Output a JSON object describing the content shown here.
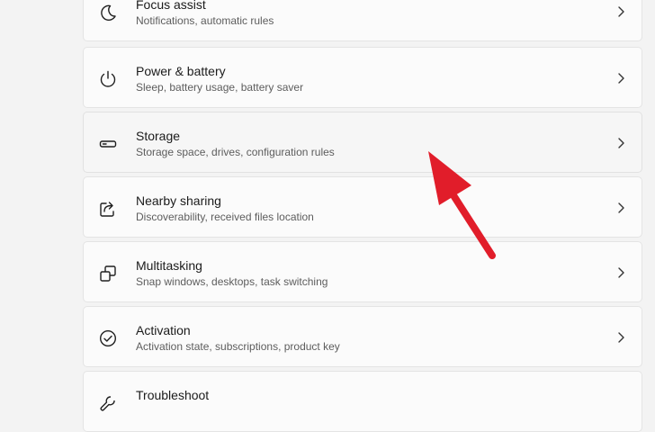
{
  "settings": {
    "items": [
      {
        "icon": "moon-icon",
        "title": "Focus assist",
        "subtitle": "Notifications, automatic rules"
      },
      {
        "icon": "power-icon",
        "title": "Power & battery",
        "subtitle": "Sleep, battery usage, battery saver"
      },
      {
        "icon": "storage-drive-icon",
        "title": "Storage",
        "subtitle": "Storage space, drives, configuration rules"
      },
      {
        "icon": "share-icon",
        "title": "Nearby sharing",
        "subtitle": "Discoverability, received files location"
      },
      {
        "icon": "multitasking-icon",
        "title": "Multitasking",
        "subtitle": "Snap windows, desktops, task switching"
      },
      {
        "icon": "activation-check-icon",
        "title": "Activation",
        "subtitle": "Activation state, subscriptions, product key"
      },
      {
        "icon": "troubleshoot-icon",
        "title": "Troubleshoot",
        "subtitle": ""
      }
    ]
  },
  "colors": {
    "annotation_arrow": "#e11d2a",
    "card_background": "#fbfbfb",
    "page_background": "#f3f3f3"
  }
}
